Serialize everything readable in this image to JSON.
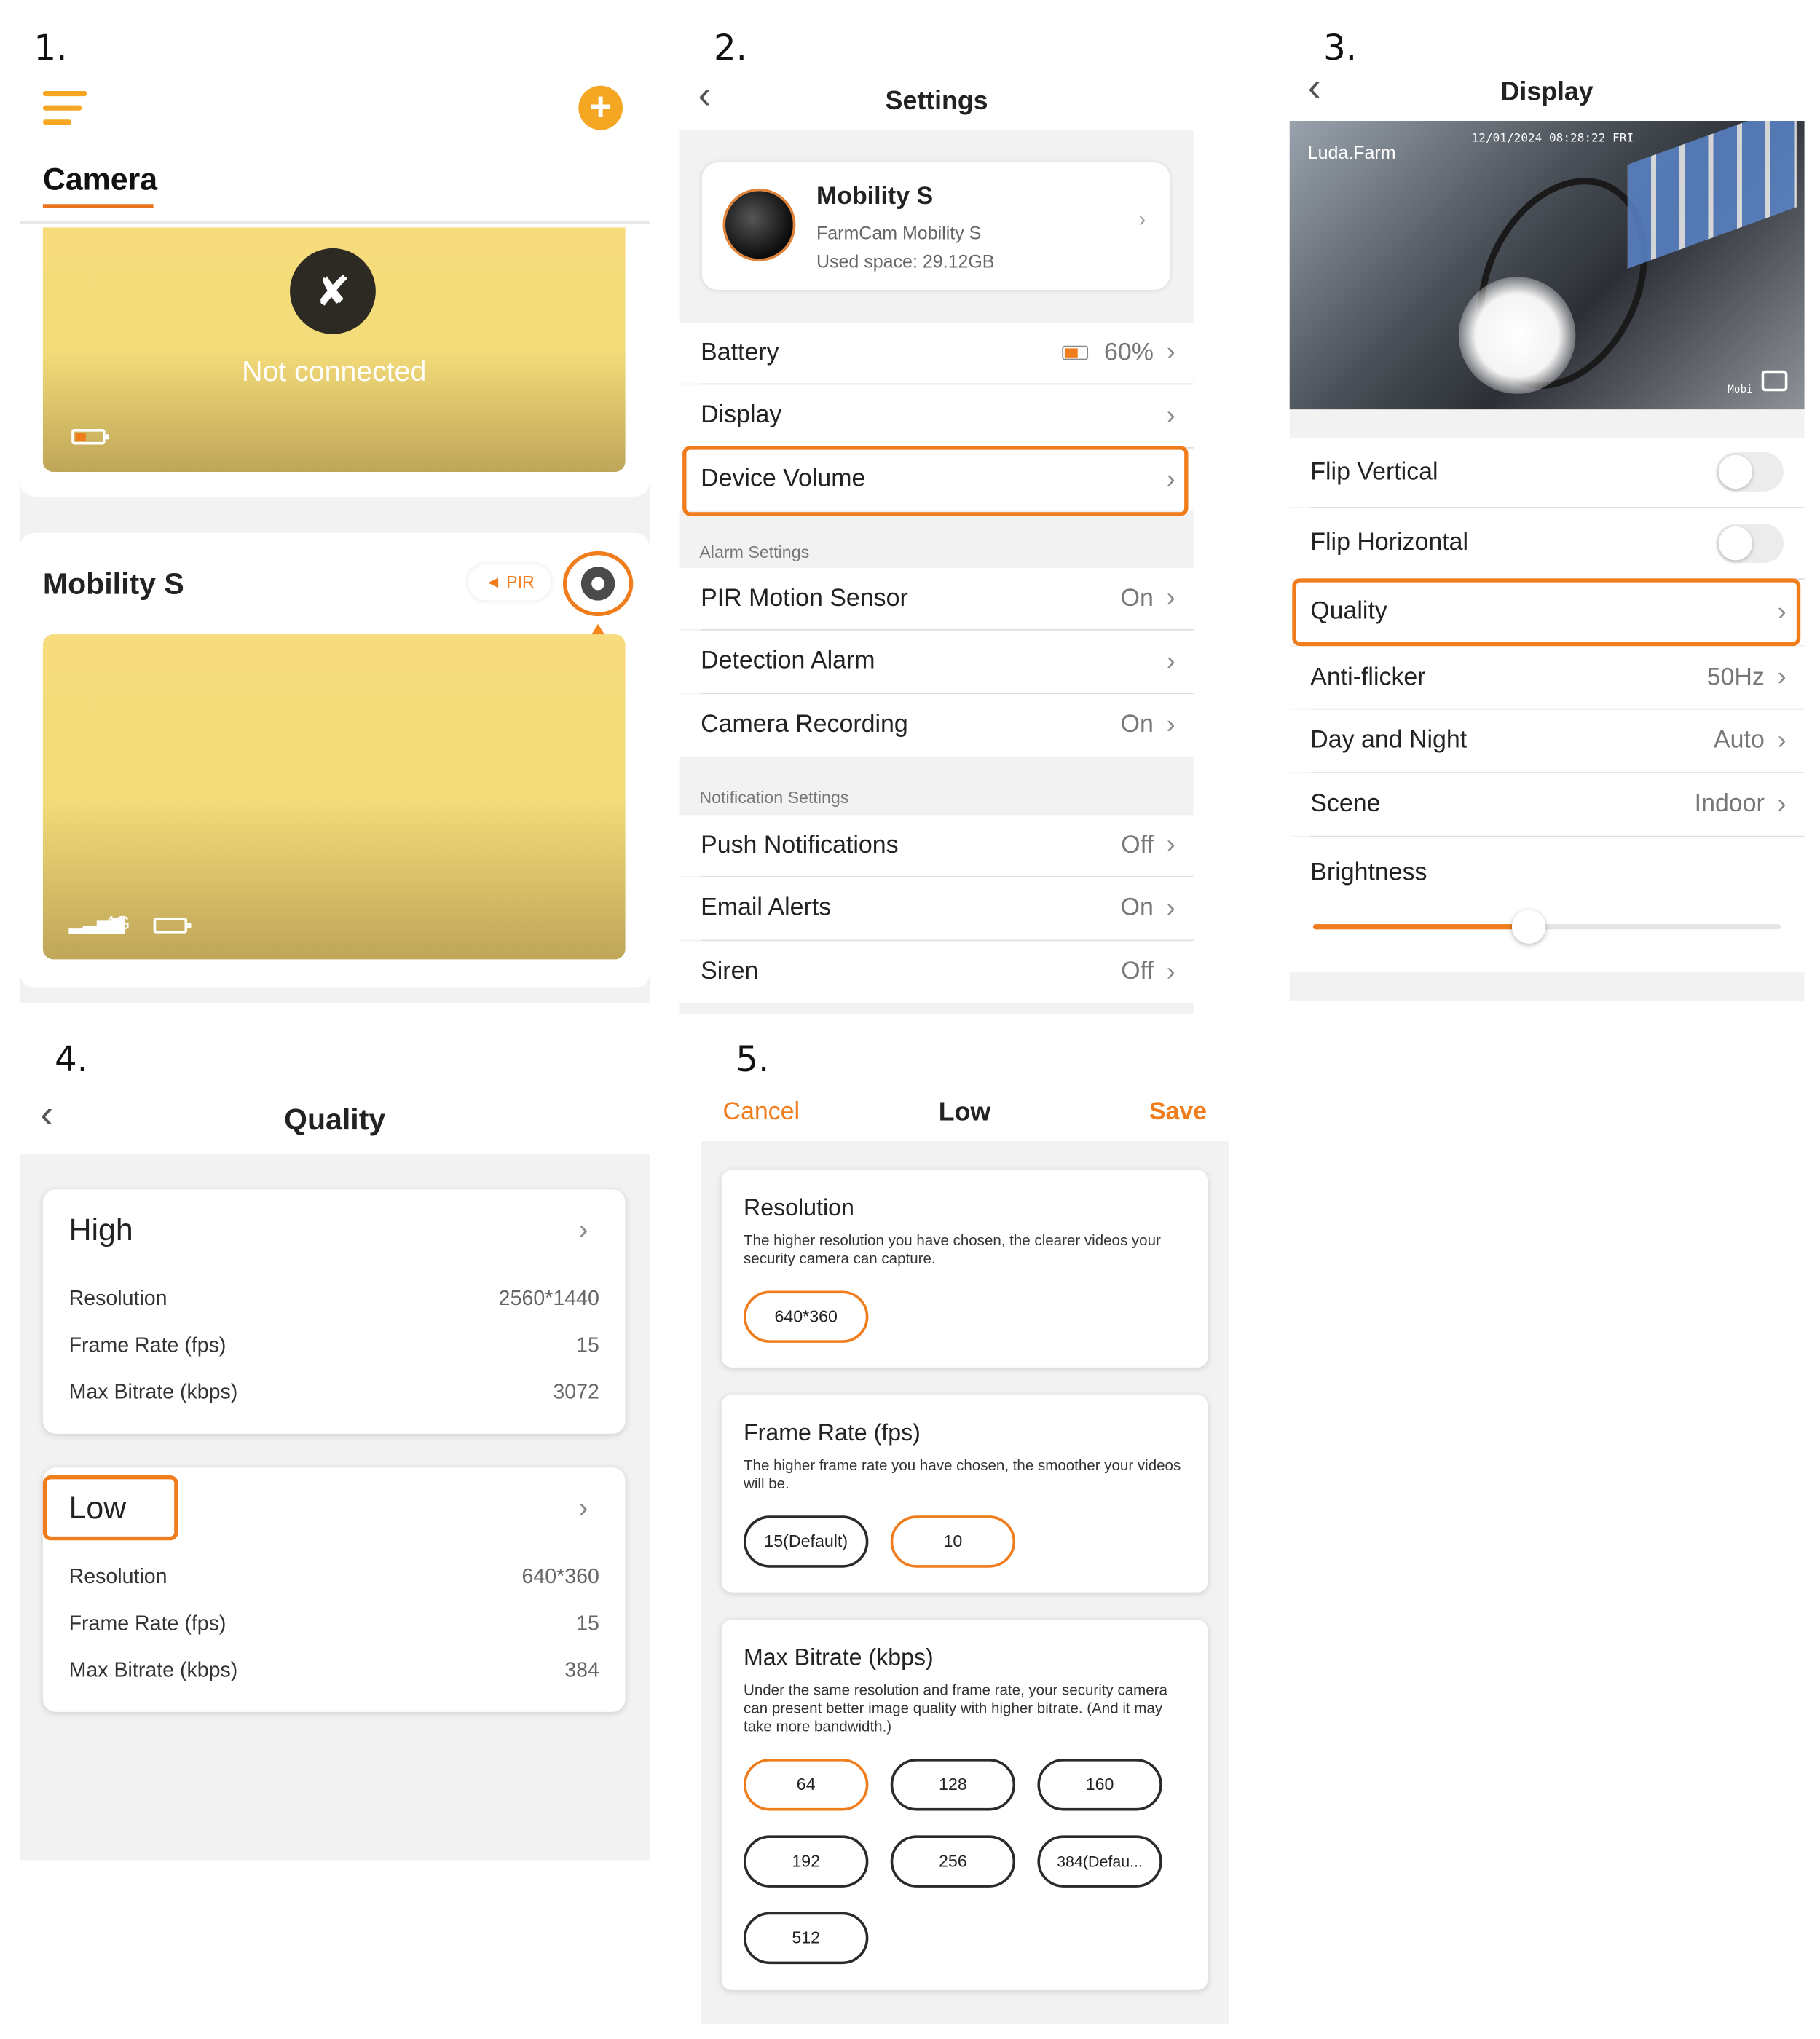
{
  "steps": [
    "1.",
    "2.",
    "3.",
    "4.",
    "5."
  ],
  "colors": {
    "accent": "#f07c1c",
    "bg_gray": "#f2f2f2",
    "card_yellow": "#f4dc7a"
  },
  "panel1": {
    "tab_label": "Camera",
    "camera1": {
      "status_text": "Not connected"
    },
    "camera2": {
      "name": "Mobility S",
      "pir_label": "PIR",
      "network_label": "4G"
    },
    "icons": [
      "menu-icon",
      "plus-icon",
      "disconnected-icon",
      "battery-icon",
      "gear-icon",
      "signal-icon",
      "speaker-icon",
      "arrow-up-icon"
    ]
  },
  "panel2": {
    "title": "Settings",
    "device": {
      "name": "Mobility S",
      "model": "FarmCam Mobility S",
      "used_space": "Used space: 29.12GB"
    },
    "rows_top": [
      {
        "label": "Battery",
        "value": "60%"
      },
      {
        "label": "Display",
        "value": ""
      },
      {
        "label": "Device Volume",
        "value": ""
      }
    ],
    "alarm_caption": "Alarm Settings",
    "rows_alarm": [
      {
        "label": "PIR Motion Sensor",
        "value": "On"
      },
      {
        "label": "Detection Alarm",
        "value": ""
      },
      {
        "label": "Camera Recording",
        "value": "On"
      }
    ],
    "notif_caption": "Notification Settings",
    "rows_notif": [
      {
        "label": "Push Notifications",
        "value": "Off"
      },
      {
        "label": "Email Alerts",
        "value": "On"
      },
      {
        "label": "Siren",
        "value": "Off"
      }
    ]
  },
  "panel3": {
    "title": "Display",
    "preview": {
      "watermark": "Luda.Farm",
      "timestamp": "12/01/2024 08:28:22 FRI",
      "corner_text": "Mobi"
    },
    "rows": [
      {
        "label": "Flip Vertical",
        "value": ""
      },
      {
        "label": "Flip Horizontal",
        "value": ""
      },
      {
        "label": "Quality",
        "value": ""
      },
      {
        "label": "Anti-flicker",
        "value": "50Hz"
      },
      {
        "label": "Day and Night",
        "value": "Auto"
      },
      {
        "label": "Scene",
        "value": "Indoor"
      }
    ],
    "brightness_label": "Brightness",
    "brightness_level": 0.46,
    "flip_vertical_on": false,
    "flip_horizontal_on": false
  },
  "panel4": {
    "title": "Quality",
    "cards": [
      {
        "name": "High",
        "rows": [
          {
            "k": "Resolution",
            "v": "2560*1440"
          },
          {
            "k": "Frame Rate (fps)",
            "v": "15"
          },
          {
            "k": "Max Bitrate (kbps)",
            "v": "3072"
          }
        ]
      },
      {
        "name": "Low",
        "rows": [
          {
            "k": "Resolution",
            "v": "640*360"
          },
          {
            "k": "Frame Rate (fps)",
            "v": "15"
          },
          {
            "k": "Max Bitrate (kbps)",
            "v": "384"
          }
        ]
      }
    ]
  },
  "panel5": {
    "cancel_label": "Cancel",
    "title": "Low",
    "save_label": "Save",
    "resolution": {
      "title": "Resolution",
      "desc": "The higher resolution you have chosen, the clearer videos your security camera can capture.",
      "options": [
        "640*360"
      ],
      "selected": "640*360"
    },
    "frame_rate": {
      "title": "Frame Rate (fps)",
      "desc": "The higher frame rate you have chosen, the smoother your videos will be.",
      "options": [
        "15(Default)",
        "10"
      ],
      "selected": "10"
    },
    "bitrate": {
      "title": "Max Bitrate (kbps)",
      "desc": "Under the same resolution and frame rate, your security camera can present better image quality with higher bitrate. (And it may take more bandwidth.)",
      "options": [
        "64",
        "128",
        "160",
        "192",
        "256",
        "384(Defau...",
        "512"
      ],
      "selected": "64"
    }
  }
}
